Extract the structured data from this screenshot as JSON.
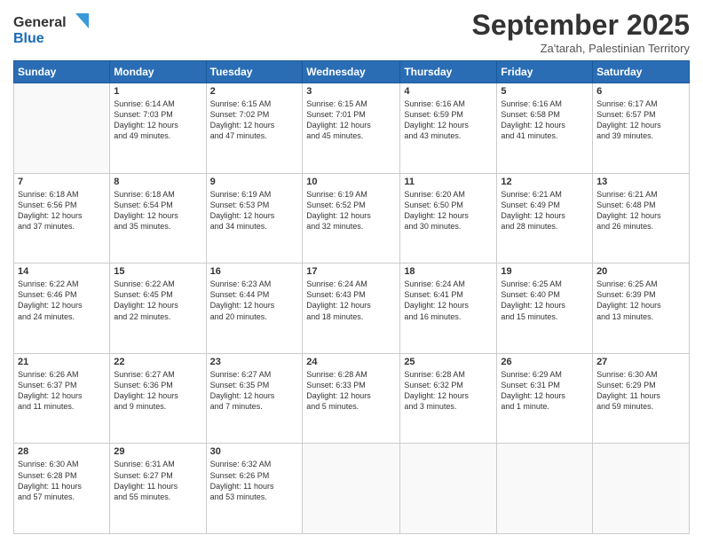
{
  "header": {
    "logo_general": "General",
    "logo_blue": "Blue",
    "month": "September 2025",
    "location": "Za'tarah, Palestinian Territory"
  },
  "days_of_week": [
    "Sunday",
    "Monday",
    "Tuesday",
    "Wednesday",
    "Thursday",
    "Friday",
    "Saturday"
  ],
  "weeks": [
    [
      {
        "day": "",
        "info": ""
      },
      {
        "day": "1",
        "info": "Sunrise: 6:14 AM\nSunset: 7:03 PM\nDaylight: 12 hours\nand 49 minutes."
      },
      {
        "day": "2",
        "info": "Sunrise: 6:15 AM\nSunset: 7:02 PM\nDaylight: 12 hours\nand 47 minutes."
      },
      {
        "day": "3",
        "info": "Sunrise: 6:15 AM\nSunset: 7:01 PM\nDaylight: 12 hours\nand 45 minutes."
      },
      {
        "day": "4",
        "info": "Sunrise: 6:16 AM\nSunset: 6:59 PM\nDaylight: 12 hours\nand 43 minutes."
      },
      {
        "day": "5",
        "info": "Sunrise: 6:16 AM\nSunset: 6:58 PM\nDaylight: 12 hours\nand 41 minutes."
      },
      {
        "day": "6",
        "info": "Sunrise: 6:17 AM\nSunset: 6:57 PM\nDaylight: 12 hours\nand 39 minutes."
      }
    ],
    [
      {
        "day": "7",
        "info": "Sunrise: 6:18 AM\nSunset: 6:56 PM\nDaylight: 12 hours\nand 37 minutes."
      },
      {
        "day": "8",
        "info": "Sunrise: 6:18 AM\nSunset: 6:54 PM\nDaylight: 12 hours\nand 35 minutes."
      },
      {
        "day": "9",
        "info": "Sunrise: 6:19 AM\nSunset: 6:53 PM\nDaylight: 12 hours\nand 34 minutes."
      },
      {
        "day": "10",
        "info": "Sunrise: 6:19 AM\nSunset: 6:52 PM\nDaylight: 12 hours\nand 32 minutes."
      },
      {
        "day": "11",
        "info": "Sunrise: 6:20 AM\nSunset: 6:50 PM\nDaylight: 12 hours\nand 30 minutes."
      },
      {
        "day": "12",
        "info": "Sunrise: 6:21 AM\nSunset: 6:49 PM\nDaylight: 12 hours\nand 28 minutes."
      },
      {
        "day": "13",
        "info": "Sunrise: 6:21 AM\nSunset: 6:48 PM\nDaylight: 12 hours\nand 26 minutes."
      }
    ],
    [
      {
        "day": "14",
        "info": "Sunrise: 6:22 AM\nSunset: 6:46 PM\nDaylight: 12 hours\nand 24 minutes."
      },
      {
        "day": "15",
        "info": "Sunrise: 6:22 AM\nSunset: 6:45 PM\nDaylight: 12 hours\nand 22 minutes."
      },
      {
        "day": "16",
        "info": "Sunrise: 6:23 AM\nSunset: 6:44 PM\nDaylight: 12 hours\nand 20 minutes."
      },
      {
        "day": "17",
        "info": "Sunrise: 6:24 AM\nSunset: 6:43 PM\nDaylight: 12 hours\nand 18 minutes."
      },
      {
        "day": "18",
        "info": "Sunrise: 6:24 AM\nSunset: 6:41 PM\nDaylight: 12 hours\nand 16 minutes."
      },
      {
        "day": "19",
        "info": "Sunrise: 6:25 AM\nSunset: 6:40 PM\nDaylight: 12 hours\nand 15 minutes."
      },
      {
        "day": "20",
        "info": "Sunrise: 6:25 AM\nSunset: 6:39 PM\nDaylight: 12 hours\nand 13 minutes."
      }
    ],
    [
      {
        "day": "21",
        "info": "Sunrise: 6:26 AM\nSunset: 6:37 PM\nDaylight: 12 hours\nand 11 minutes."
      },
      {
        "day": "22",
        "info": "Sunrise: 6:27 AM\nSunset: 6:36 PM\nDaylight: 12 hours\nand 9 minutes."
      },
      {
        "day": "23",
        "info": "Sunrise: 6:27 AM\nSunset: 6:35 PM\nDaylight: 12 hours\nand 7 minutes."
      },
      {
        "day": "24",
        "info": "Sunrise: 6:28 AM\nSunset: 6:33 PM\nDaylight: 12 hours\nand 5 minutes."
      },
      {
        "day": "25",
        "info": "Sunrise: 6:28 AM\nSunset: 6:32 PM\nDaylight: 12 hours\nand 3 minutes."
      },
      {
        "day": "26",
        "info": "Sunrise: 6:29 AM\nSunset: 6:31 PM\nDaylight: 12 hours\nand 1 minute."
      },
      {
        "day": "27",
        "info": "Sunrise: 6:30 AM\nSunset: 6:29 PM\nDaylight: 11 hours\nand 59 minutes."
      }
    ],
    [
      {
        "day": "28",
        "info": "Sunrise: 6:30 AM\nSunset: 6:28 PM\nDaylight: 11 hours\nand 57 minutes."
      },
      {
        "day": "29",
        "info": "Sunrise: 6:31 AM\nSunset: 6:27 PM\nDaylight: 11 hours\nand 55 minutes."
      },
      {
        "day": "30",
        "info": "Sunrise: 6:32 AM\nSunset: 6:26 PM\nDaylight: 11 hours\nand 53 minutes."
      },
      {
        "day": "",
        "info": ""
      },
      {
        "day": "",
        "info": ""
      },
      {
        "day": "",
        "info": ""
      },
      {
        "day": "",
        "info": ""
      }
    ]
  ]
}
